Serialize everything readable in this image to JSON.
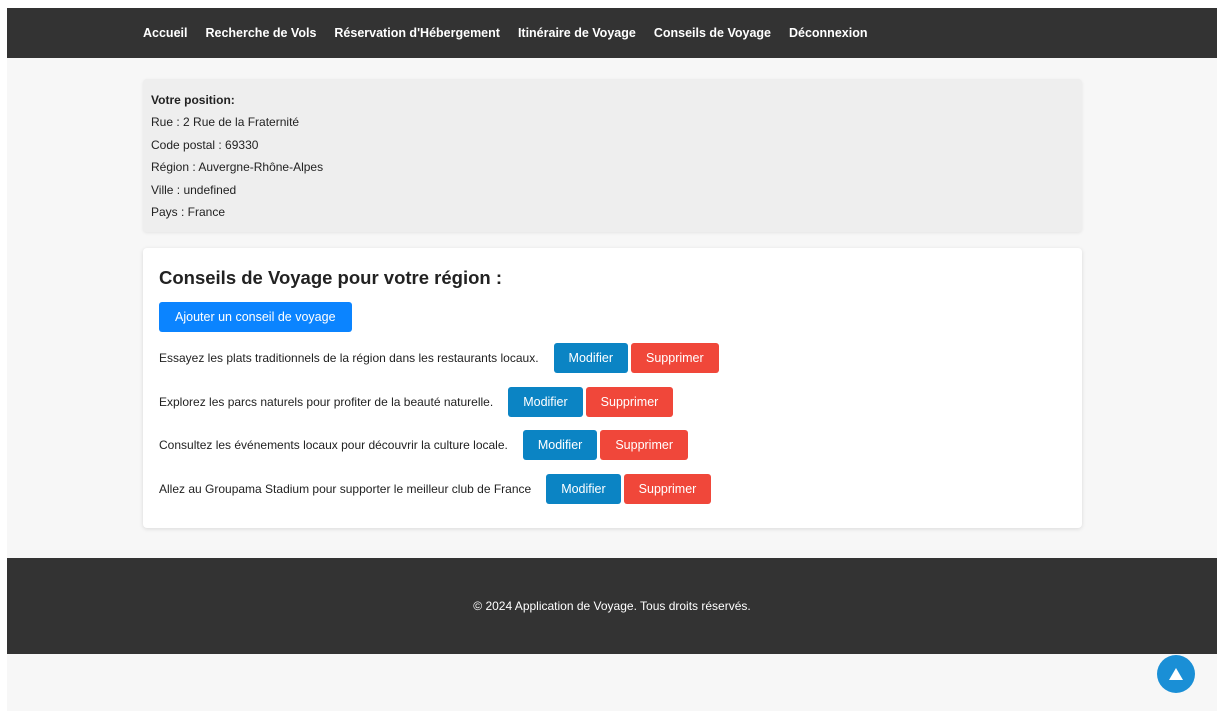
{
  "nav": {
    "items": [
      {
        "label": "Accueil"
      },
      {
        "label": "Recherche de Vols"
      },
      {
        "label": "Réservation d'Hébergement"
      },
      {
        "label": "Itinéraire de Voyage"
      },
      {
        "label": "Conseils de Voyage"
      },
      {
        "label": "Déconnexion"
      }
    ]
  },
  "location": {
    "title": "Votre position:",
    "street": "Rue : 2 Rue de la Fraternité",
    "postal_code": "Code postal : 69330",
    "region": "Région : Auvergne-Rhône-Alpes",
    "city": "Ville : undefined",
    "country": "Pays : France"
  },
  "tips": {
    "title": "Conseils de Voyage pour votre région :",
    "add_label": "Ajouter un conseil de voyage",
    "modify_label": "Modifier",
    "delete_label": "Supprimer",
    "items": [
      {
        "text": "Essayez les plats traditionnels de la région dans les restaurants locaux."
      },
      {
        "text": "Explorez les parcs naturels pour profiter de la beauté naturelle."
      },
      {
        "text": "Consultez les événements locaux pour découvrir la culture locale."
      },
      {
        "text": "Allez au Groupama Stadium pour supporter le meilleur club de France"
      }
    ]
  },
  "footer": {
    "text": "© 2024 Application de Voyage. Tous droits réservés."
  },
  "scroll_top": {
    "icon": "arrow-up-icon"
  },
  "colors": {
    "navbar": "#333333",
    "primary_button": "#0b84ff",
    "modify_button": "#0b84c4",
    "delete_button": "#f0473a",
    "scroll_top": "#1a8fd6"
  }
}
